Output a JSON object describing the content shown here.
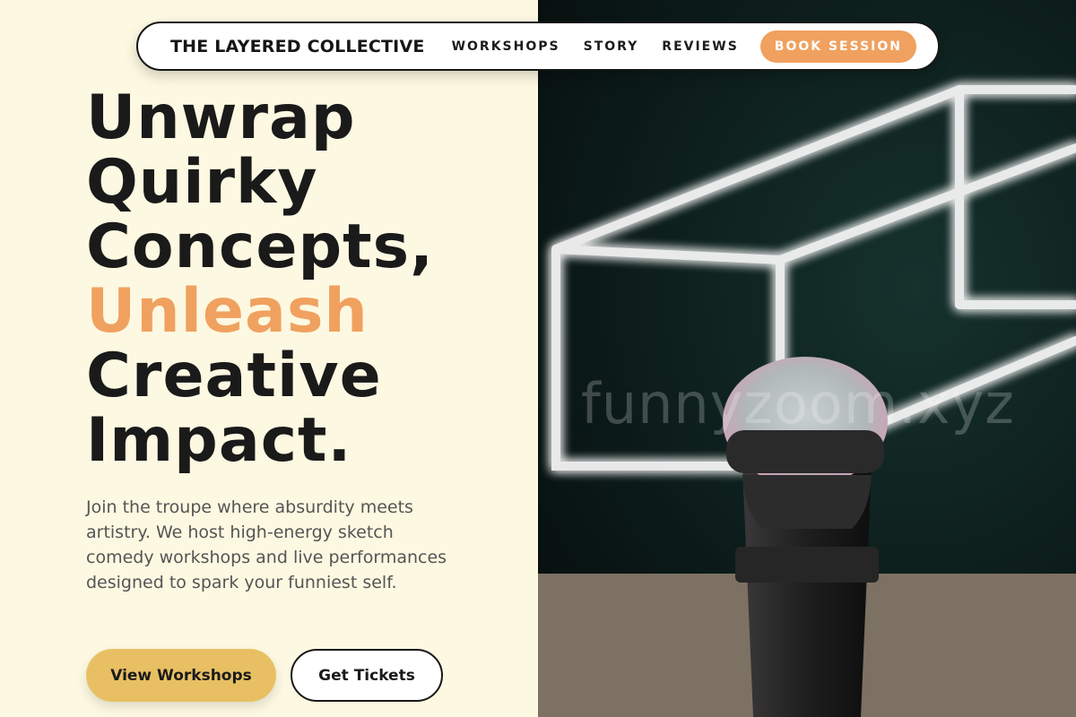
{
  "nav": {
    "brand": "THE LAYERED COLLECTIVE",
    "links": [
      "WORKSHOPS",
      "STORY",
      "REVIEWS"
    ],
    "cta": "BOOK SESSION"
  },
  "hero": {
    "headline_lines": [
      "Unwrap",
      "Quirky",
      "Concepts,",
      "Unleash",
      "Creative",
      "Impact."
    ],
    "accent_line": "Unleash",
    "intro": "Join the troupe where absurdity meets artistry. We host high-energy sketch comedy workshops and live performances designed to spark your funniest self.",
    "primary_button": "View Workshops",
    "secondary_button": "Get Tickets"
  },
  "photo": {
    "watermark": "funnyzoom.xyz",
    "subject": "microphone-with-neon-cube"
  },
  "colors": {
    "background": "#fdf8e1",
    "accent_orange": "#f0a15f",
    "button_yellow": "#e8c063",
    "text_dark": "#1a1a1a"
  }
}
